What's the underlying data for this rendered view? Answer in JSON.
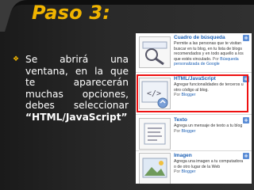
{
  "slide": {
    "title": "Paso 3:",
    "bullet_text": "Se abrirá una ventana, en la que te aparecerán muchas opciones, debes seleccionar ",
    "bullet_bold": "“HTML/JavaScript”"
  },
  "gadgets": [
    {
      "name": "Cuadro de búsqueda",
      "desc": "Permite a las personas que te visitan buscar en tu blog, en tu lista de blogs recomendados y en todo aquello a los que estés vinculado.",
      "by_label": "Por",
      "by_value": "Búsqueda personalizada de Google"
    },
    {
      "name": "HTML/JavaScript",
      "desc": "Agregar funcionalidades de terceros u otro código al blog.",
      "by_label": "Por",
      "by_value": "Blogger"
    },
    {
      "name": "Texto",
      "desc": "Agrega un mensaje de texto a tu blog",
      "by_label": "Por",
      "by_value": "Blogger"
    },
    {
      "name": "Imagen",
      "desc": "Agrega una imagen a tu computadora o de otro lugar de la Web",
      "by_label": "Por",
      "by_value": "Blogger"
    }
  ],
  "colors": {
    "title": "#f0b400",
    "highlight": "#e11111",
    "link": "#1a5fb4"
  },
  "icons": {
    "add": "plus-icon",
    "bullet": "diamond-bullet-icon"
  }
}
